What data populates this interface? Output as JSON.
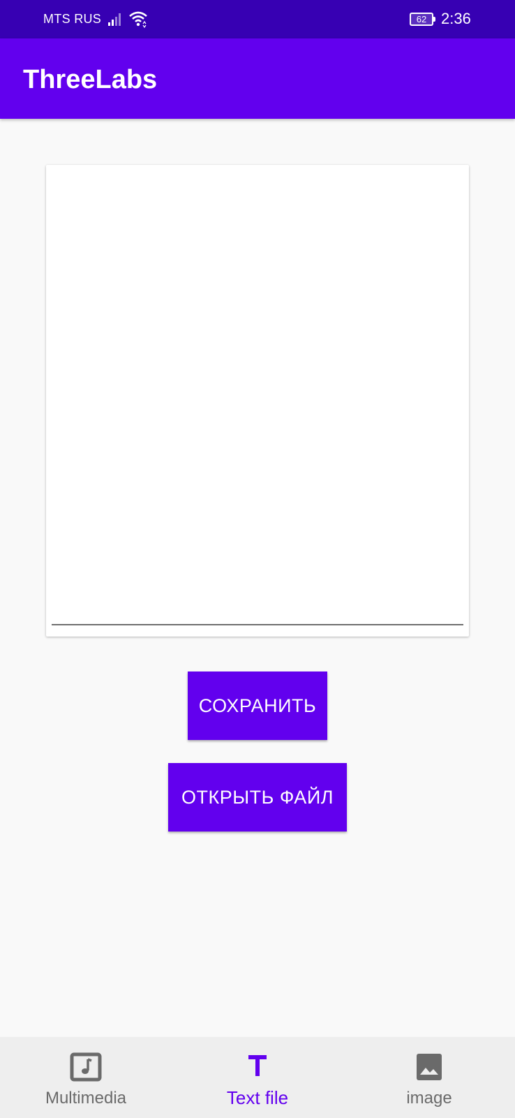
{
  "status_bar": {
    "carrier": "MTS RUS",
    "battery_level": "62",
    "time": "2:36"
  },
  "app_bar": {
    "title": "ThreeLabs"
  },
  "editor": {
    "value": "",
    "placeholder": ""
  },
  "buttons": {
    "save_label": "СОХРАНИТЬ",
    "open_label": "ОТКРЫТЬ ФАЙЛ"
  },
  "bottom_nav": {
    "items": [
      {
        "label": "Multimedia",
        "icon": "music-note-icon",
        "active": false
      },
      {
        "label": "Text file",
        "icon": "text-t-icon",
        "active": true
      },
      {
        "label": "image",
        "icon": "image-icon",
        "active": false
      }
    ]
  },
  "colors": {
    "primary": "#6200ee",
    "primary_dark": "#3700b3",
    "background": "#f9f9f9",
    "nav_background": "#eeeeee",
    "inactive": "#6a6a6a"
  }
}
